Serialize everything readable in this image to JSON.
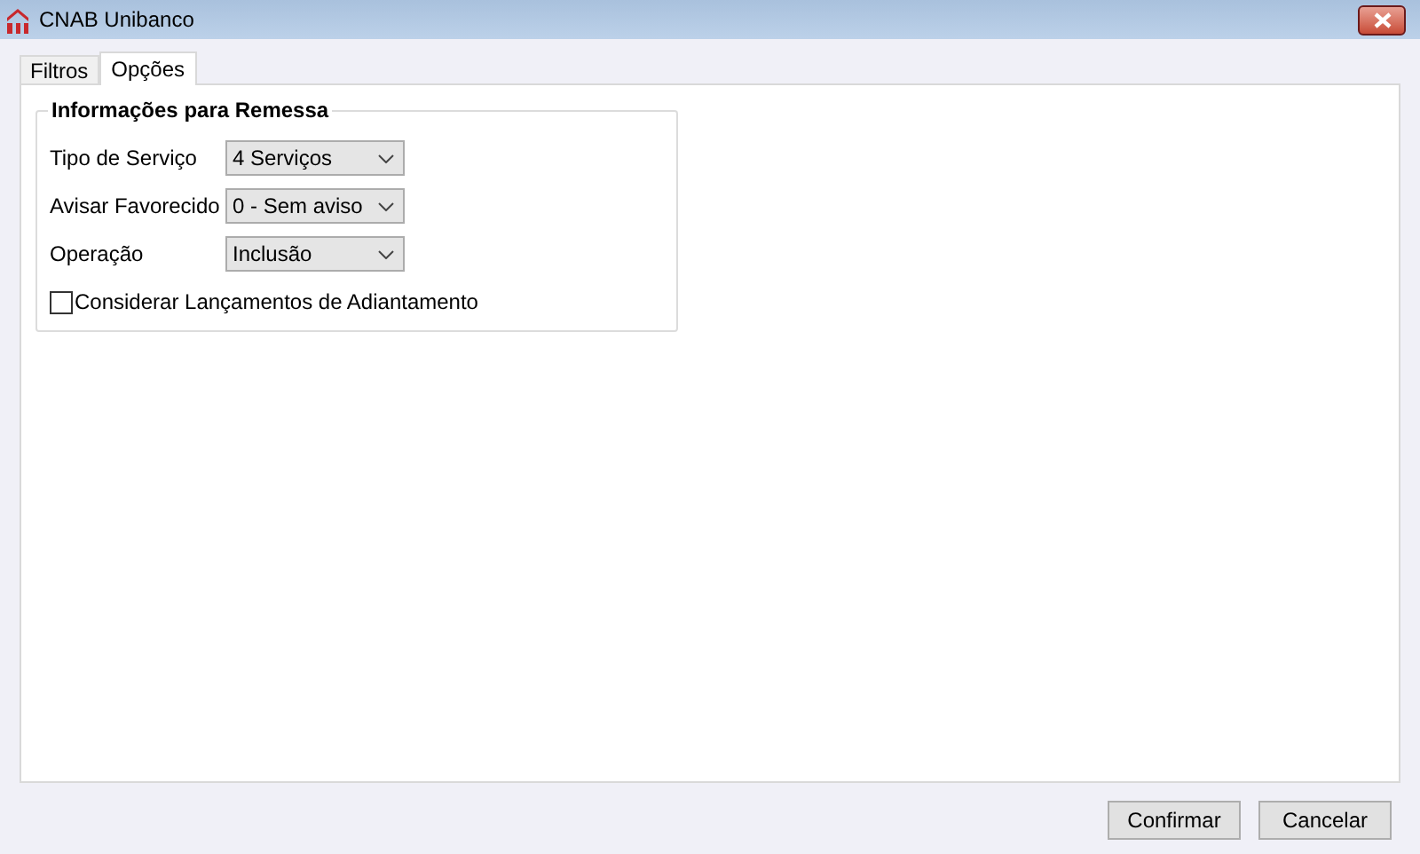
{
  "window": {
    "title": "CNAB Unibanco"
  },
  "tabs": [
    {
      "label": "Filtros",
      "selected": false
    },
    {
      "label": "Opções",
      "selected": true
    }
  ],
  "group": {
    "title": "Informações para Remessa",
    "fields": [
      {
        "label": "Tipo de Serviço",
        "value": "4 Serviços"
      },
      {
        "label": "Avisar Favorecido",
        "value": "0 - Sem aviso"
      },
      {
        "label": "Operação",
        "value": "Inclusão"
      }
    ],
    "checkbox": {
      "label": "Considerar Lançamentos de Adiantamento",
      "checked": false
    }
  },
  "buttons": [
    "Confirmar",
    "Cancelar"
  ]
}
